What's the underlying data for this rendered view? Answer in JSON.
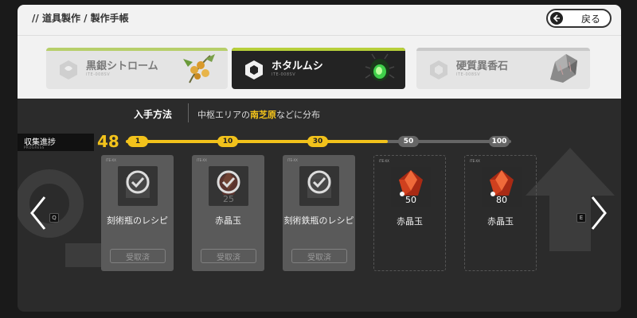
{
  "header": {
    "breadcrumb": "// 道具製作 / 製作手帳",
    "back_label": "戻る"
  },
  "tabs": [
    {
      "name": "黒銀シトローム",
      "code": "ITE-008SV",
      "art": "plant-art",
      "selected": false
    },
    {
      "name": "ホタルムシ",
      "code": "ITE-008SV",
      "art": "beetle-art",
      "selected": true
    },
    {
      "name": "硬質異香石",
      "code": "ITE-008SV",
      "art": "rock-art",
      "selected": false
    }
  ],
  "acquisition": {
    "label": "入手方法",
    "prefix": "中枢エリアの",
    "highlight": "南芝原",
    "suffix": "などに分布"
  },
  "progress": {
    "label": "収集進捗",
    "sublabel": "PROGRESS",
    "value": "48",
    "current": 48,
    "milestones": [
      "1",
      "10",
      "30",
      "50",
      "100"
    ]
  },
  "rewards": [
    {
      "title": "刻術瓶のレシピ",
      "code": "ITE-XX",
      "qty": "",
      "claim_label": "受取済",
      "claimed": true,
      "icon": "recipe-icon"
    },
    {
      "title": "赤晶玉",
      "code": "ITE-XX",
      "qty": "25",
      "claim_label": "受取済",
      "claimed": true,
      "icon": "red-crystal-icon"
    },
    {
      "title": "刻術鉄瓶のレシピ",
      "code": "ITE-XX",
      "qty": "",
      "claim_label": "受取済",
      "claimed": true,
      "icon": "recipe-icon"
    },
    {
      "title": "赤晶玉",
      "code": "ITE-XX",
      "qty": "50",
      "claimed": false,
      "icon": "red-crystal-icon"
    },
    {
      "title": "赤晶玉",
      "code": "ITE-XX",
      "qty": "80",
      "claimed": false,
      "icon": "red-crystal-icon"
    }
  ],
  "nav": {
    "prev_key": "Q",
    "next_key": "E"
  },
  "colors": {
    "accent": "#f2c21b",
    "tab_bar": "#b7cf3a"
  }
}
